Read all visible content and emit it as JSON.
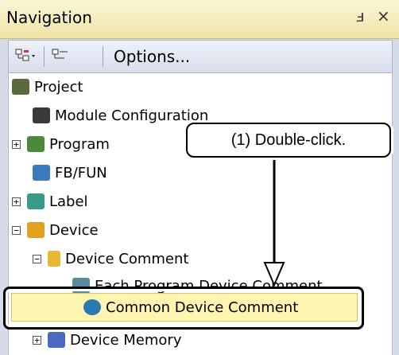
{
  "window": {
    "title": "Navigation",
    "pin_glyph": "ⅎ",
    "close_glyph": "×"
  },
  "toolbar": {
    "options_label": "Options..."
  },
  "tree": {
    "project": "Project",
    "module_configuration": "Module Configuration",
    "program": "Program",
    "fb_fun": "FB/FUN",
    "label": "Label",
    "device": "Device",
    "device_comment": "Device Comment",
    "each_program_device_comment": "Each Program Device Comment",
    "common_device_comment": "Common Device Comment",
    "device_memory": "Device Memory"
  },
  "annotation": {
    "callout_text": "(1) Double-click."
  },
  "colors": {
    "selected_row": "#fff4b0",
    "title_bar": "#efe4a6"
  }
}
